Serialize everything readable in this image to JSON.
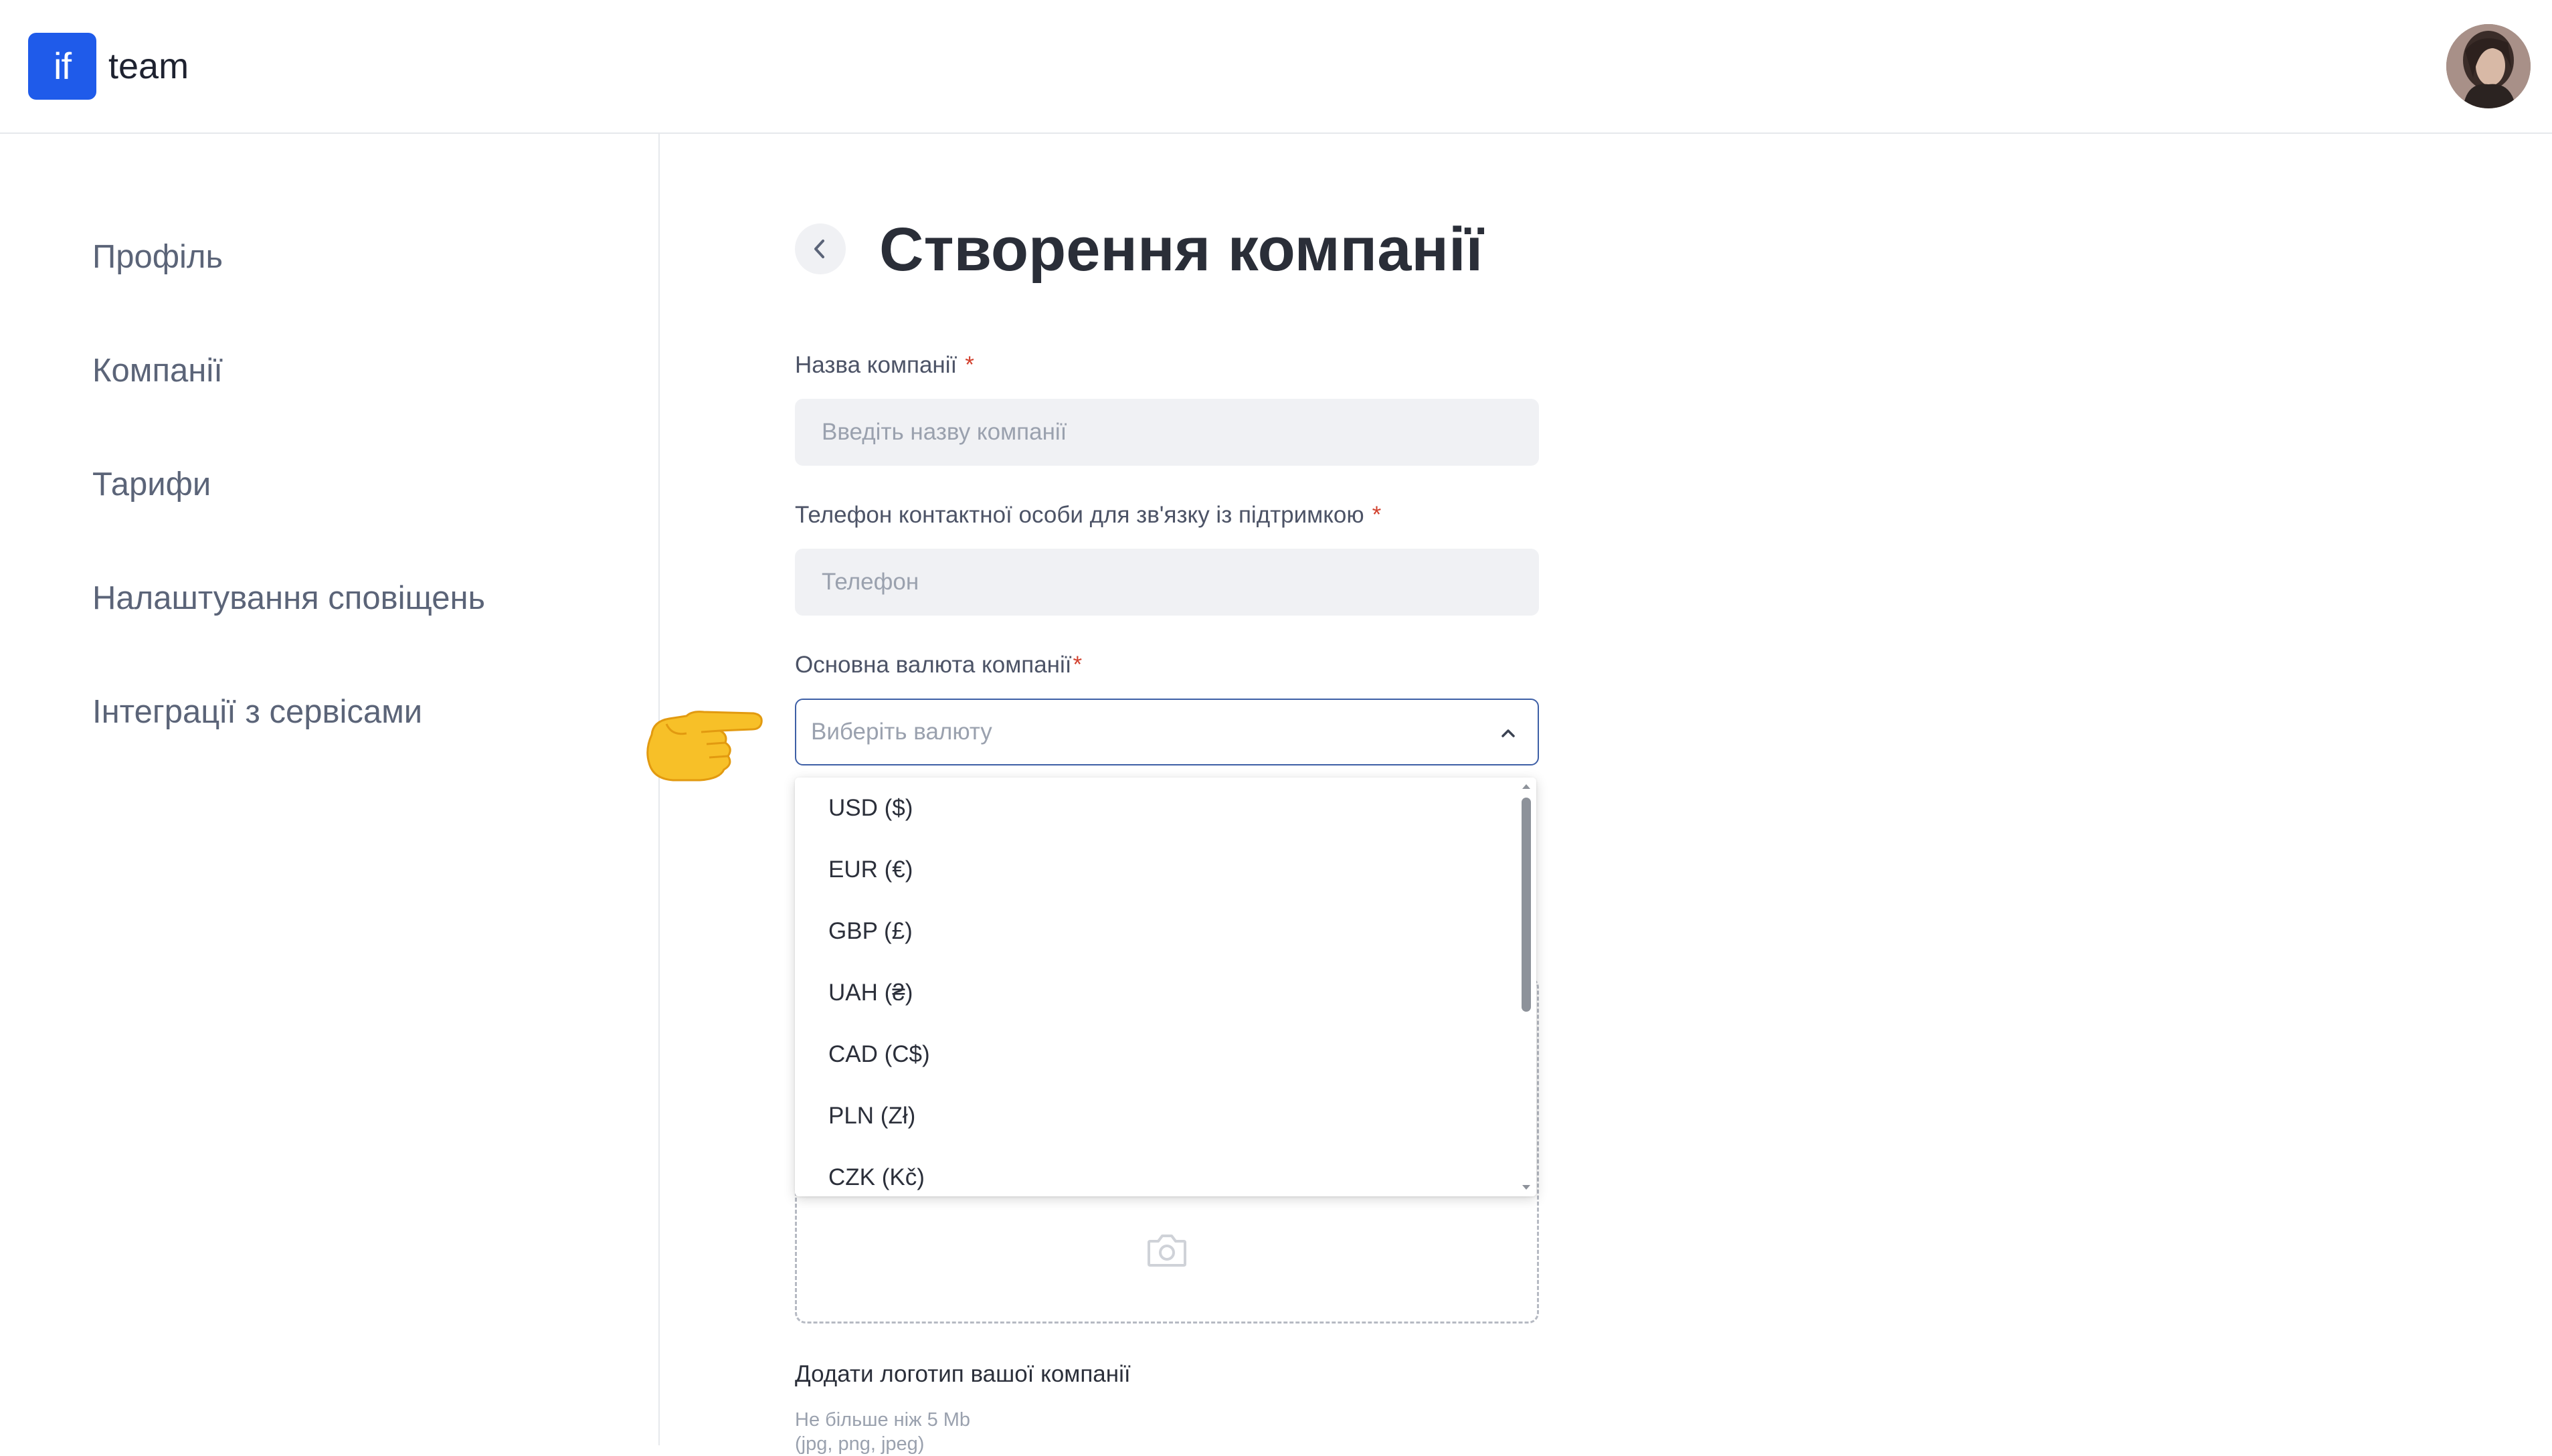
{
  "header": {
    "logo_mark": "if",
    "logo_text": "team"
  },
  "sidebar": {
    "items": [
      {
        "label": "Профіль"
      },
      {
        "label": "Компанії"
      },
      {
        "label": "Тарифи"
      },
      {
        "label": "Налаштування сповіщень"
      },
      {
        "label": "Інтеграції з сервісами"
      }
    ]
  },
  "page": {
    "title": "Створення компанії"
  },
  "form": {
    "company_name": {
      "label": "Назва компанії",
      "required_mark": "*",
      "placeholder": "Введіть назву компанії",
      "value": ""
    },
    "phone": {
      "label": "Телефон контактної особи для зв'язку із підтримкою",
      "required_mark": "*",
      "placeholder": "Телефон",
      "value": ""
    },
    "currency": {
      "label": "Основна валюта компанії",
      "required_mark": "*",
      "placeholder": "Виберіть валюту",
      "expanded": true,
      "options": [
        "USD ($)",
        "EUR (€)",
        "GBP (£)",
        "UAH (₴)",
        "CAD (C$)",
        "PLN (Zł)",
        "CZK (Kč)"
      ]
    },
    "logo": {
      "label": "Додати логотип вашої компанії",
      "hint": "Не більше ніж 5 Mb",
      "hint_partial": "(jpg, png, jpeg)"
    }
  },
  "colors": {
    "brand": "#1f5bea",
    "required": "#d2422f",
    "select_border": "#3d5fa6",
    "input_bg": "#f0f1f4"
  },
  "icons": [
    "back-arrow-icon",
    "chevron-up-icon",
    "camera-icon",
    "pointing-hand-icon",
    "scroll-up-arrow-icon",
    "scroll-down-arrow-icon"
  ]
}
